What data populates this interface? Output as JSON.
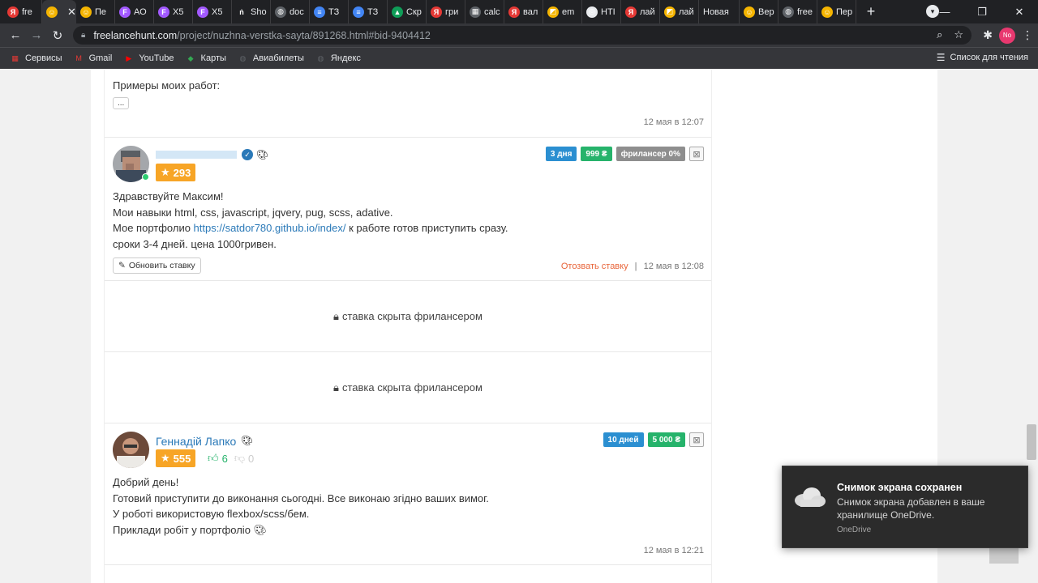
{
  "browser": {
    "tabs": [
      {
        "label": "fre",
        "icon": "Я",
        "color": "#e53935"
      },
      {
        "label": "",
        "icon": "☺",
        "color": "#f4b400",
        "active": true
      },
      {
        "label": "Пе",
        "icon": "☺",
        "color": "#f4b400"
      },
      {
        "label": "АО",
        "icon": "F",
        "color": "#a259ff"
      },
      {
        "label": "Х5",
        "icon": "F",
        "color": "#a259ff"
      },
      {
        "label": "Х5",
        "icon": "F",
        "color": "#a259ff"
      },
      {
        "label": "Sho",
        "icon": "ṅ",
        "color": "#202124"
      },
      {
        "label": "doc",
        "icon": "◍",
        "color": "#5f6368"
      },
      {
        "label": "ТЗ",
        "icon": "≡",
        "color": "#4285f4"
      },
      {
        "label": "ТЗ",
        "icon": "≡",
        "color": "#4285f4"
      },
      {
        "label": "Скр",
        "icon": "▲",
        "color": "#0f9d58"
      },
      {
        "label": "гри",
        "icon": "Я",
        "color": "#e53935"
      },
      {
        "label": "calc",
        "icon": "▦",
        "color": "#5f6368"
      },
      {
        "label": "вал",
        "icon": "Я",
        "color": "#e53935"
      },
      {
        "label": "em",
        "icon": "◩",
        "color": "#f4b400"
      },
      {
        "label": "НТІ",
        "icon": "◎",
        "color": "#e8eaed"
      },
      {
        "label": "лай",
        "icon": "Я",
        "color": "#e53935"
      },
      {
        "label": "лай",
        "icon": "◩",
        "color": "#f4b400"
      },
      {
        "label": "Новая",
        "icon": "",
        "color": "#202124"
      },
      {
        "label": "Вер",
        "icon": "☺",
        "color": "#f4b400"
      },
      {
        "label": "free",
        "icon": "◍",
        "color": "#5f6368"
      },
      {
        "label": "Пер",
        "icon": "☺",
        "color": "#f4b400"
      }
    ],
    "close_symbol": "✕",
    "new_tab_symbol": "+",
    "url_host": "freelancehunt.com",
    "url_path": "/project/nuzhna-verstka-sayta/891268.html#bid-9404412",
    "profile_initials": "No",
    "bookmarks": [
      {
        "label": "Сервисы",
        "icon": "▦",
        "color": "#e53935"
      },
      {
        "label": "Gmail",
        "icon": "M",
        "color": "#e53935"
      },
      {
        "label": "YouTube",
        "icon": "▶",
        "color": "#ff0000"
      },
      {
        "label": "Карты",
        "icon": "◆",
        "color": "#34a853"
      },
      {
        "label": "Авиабилеты",
        "icon": "◍",
        "color": "#5f6368"
      },
      {
        "label": "Яндекс",
        "icon": "◍",
        "color": "#5f6368"
      }
    ],
    "reading_list": "Список для чтения"
  },
  "bids": {
    "first_fragment": {
      "text": "Примеры моих работ:",
      "ellipsis": "...",
      "time": "12 мая в 12:07"
    },
    "bid1": {
      "rating": "293",
      "badges": {
        "days": "3 дня",
        "price": "999 ₴",
        "freelancer": "фрилансер 0%"
      },
      "lines": [
        "Здравствуйте Максим!",
        "Мои навыки html, css, javascript, jqvery, pug, scss, adative."
      ],
      "portfolio_prefix": "Мое портфолио ",
      "portfolio_link": "https://satdor780.github.io/index/",
      "portfolio_suffix": " к работе готов приступить сразу.",
      "last_line": "сроки 3-4 дней. цена 1000гривен.",
      "update_button": "Обновить ставку",
      "recall_link": "Отозвать ставку",
      "separator": "|",
      "time": "12 мая в 12:08"
    },
    "hidden_bid_text": "ставка скрыта фрилансером",
    "bid2": {
      "name": "Геннадій Лапко",
      "rating": "555",
      "votes_up": "6",
      "votes_down": "0",
      "badges": {
        "days": "10 дней",
        "price": "5 000 ₴"
      },
      "lines": [
        "Добрий день!",
        "Готовий приступити до виконання сьогодні. Все виконаю згідно ваших вимог.",
        "У роботі використовую flexbox/scss/бем.",
        "Приклади робіт у портфоліо"
      ],
      "time": "12 мая в 12:21"
    }
  },
  "toast": {
    "title": "Снимок экрана сохранен",
    "body": "Снимок экрана добавлен в ваше хранилище OneDrive.",
    "source": "OneDrive"
  },
  "colors": {
    "accent_link": "#2a79b8",
    "rating_orange": "#f7a526",
    "badge_blue": "#2b8fd1",
    "badge_green": "#26b36b"
  }
}
